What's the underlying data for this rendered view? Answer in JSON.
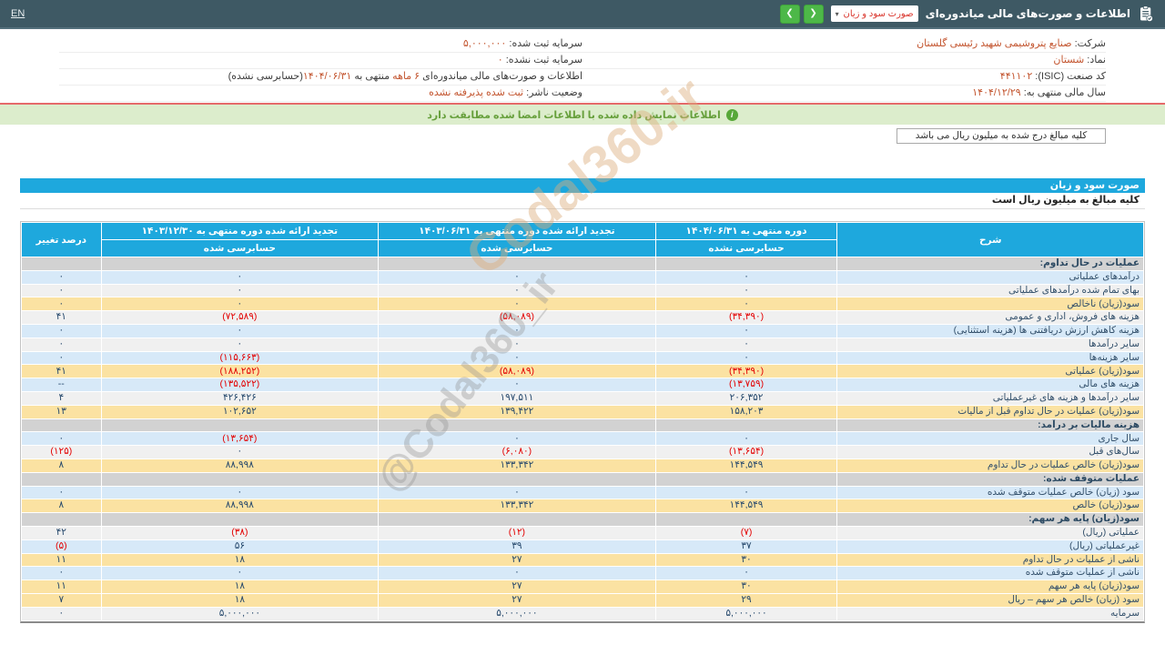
{
  "topbar": {
    "title": "اطلاعات و صورت‌های مالی میاندوره‌ای",
    "statement_select": "صورت سود و زیان",
    "caret_icon": "▾",
    "nav_back": "❮",
    "nav_forward": "❯",
    "lang_link": "EN"
  },
  "info": {
    "right_rows": [
      {
        "segments": [
          {
            "t": "شرکت: ",
            "c": "l"
          },
          {
            "t": "صنایع پتروشیمی شهید رئیسی گلستان",
            "c": "v"
          }
        ]
      },
      {
        "segments": [
          {
            "t": "نماد: ",
            "c": "l"
          },
          {
            "t": "شستان",
            "c": "v"
          }
        ]
      },
      {
        "segments": [
          {
            "t": "کد صنعت (ISIC): ",
            "c": "l"
          },
          {
            "t": "۴۴۱۱۰۲",
            "c": "v"
          }
        ]
      },
      {
        "segments": [
          {
            "t": "سال مالی منتهی به: ",
            "c": "l"
          },
          {
            "t": "۱۴۰۴/۱۲/۲۹",
            "c": "v"
          }
        ]
      }
    ],
    "left_rows": [
      {
        "segments": [
          {
            "t": "سرمایه ثبت شده: ",
            "c": "l"
          },
          {
            "t": "۵,۰۰۰,۰۰۰",
            "c": "v"
          }
        ]
      },
      {
        "segments": [
          {
            "t": "سرمایه ثبت نشده: ",
            "c": "l"
          },
          {
            "t": "۰",
            "c": "v"
          }
        ]
      },
      {
        "segments": [
          {
            "t": "اطلاعات و صورت‌های مالی میاندوره‌ای ",
            "c": "l"
          },
          {
            "t": "۶ ماهه",
            "c": "v"
          },
          {
            "t": " منتهی به ",
            "c": "l"
          },
          {
            "t": "۱۴۰۴/۰۶/۳۱",
            "c": "v"
          },
          {
            "t": "(حسابرسی نشده)",
            "c": "l"
          }
        ]
      },
      {
        "segments": [
          {
            "t": "وضعیت ناشر: ",
            "c": "l"
          },
          {
            "t": "ثبت شده پذیرفته نشده",
            "c": "v"
          }
        ]
      }
    ]
  },
  "bars": {
    "signed_match": "اطلاعات نمایش داده شده با اطلاعات امضا شده مطابقت دارد",
    "info_icon": "i",
    "units_note": "کلیه مبالغ درج شده به میلیون ریال می باشد"
  },
  "statement": {
    "title": "صورت سود و زیان",
    "units": "کلیه مبالغ به میلیون ریال است"
  },
  "table": {
    "desc_header": "شرح",
    "pct_header": "درصد تغییر",
    "period_cols": [
      {
        "title": "دوره منتهی به ۱۴۰۴/۰۶/۳۱",
        "sub": "حسابرسی نشده"
      },
      {
        "title": "تجدید ارائه شده دوره منتهی به ۱۴۰۳/۰۶/۳۱",
        "sub": "حسابرسی شده"
      },
      {
        "title": "تجدید ارائه شده دوره منتهی به ۱۴۰۳/۱۲/۳۰",
        "sub": "حسابرسی شده"
      }
    ],
    "rows": [
      {
        "type": "section",
        "label": "عملیات در حال تداوم:"
      },
      {
        "type": "data",
        "style": "blue",
        "label": "درآمدهای عملیاتی",
        "v": [
          "۰",
          "۰",
          "۰",
          "۰"
        ]
      },
      {
        "type": "data",
        "style": "white",
        "label": "بهای تمام شده درآمدهای عملیاتی",
        "v": [
          "۰",
          "۰",
          "۰",
          "۰"
        ]
      },
      {
        "type": "data",
        "style": "yellow",
        "label": "سود(زیان) ناخالص",
        "v": [
          "۰",
          "۰",
          "۰",
          "۰"
        ]
      },
      {
        "type": "data",
        "style": "white",
        "label": "هزینه های فروش، اداری و عمومی",
        "v": [
          "(۳۴,۳۹۰)",
          "(۵۸,۰۸۹)",
          "(۷۲,۵۸۹)",
          "۴۱"
        ]
      },
      {
        "type": "data",
        "style": "blue",
        "label": "هزینه کاهش ارزش دریافتنی ها (هزینه استثنایی)",
        "v": [
          "۰",
          "۰",
          "۰",
          "۰"
        ]
      },
      {
        "type": "data",
        "style": "white",
        "label": "سایر درآمدها",
        "v": [
          "۰",
          "۰",
          "۰",
          "۰"
        ]
      },
      {
        "type": "data",
        "style": "blue",
        "label": "سایر هزینه‌ها",
        "v": [
          "۰",
          "۰",
          "(۱۱۵,۶۶۳)",
          "۰"
        ]
      },
      {
        "type": "data",
        "style": "yellow",
        "label": "سود(زیان) عملیاتی",
        "v": [
          "(۳۴,۳۹۰)",
          "(۵۸,۰۸۹)",
          "(۱۸۸,۲۵۲)",
          "۴۱"
        ]
      },
      {
        "type": "data",
        "style": "blue",
        "label": "هزینه های مالی",
        "v": [
          "(۱۳,۷۵۹)",
          "۰",
          "(۱۳۵,۵۲۲)",
          "--"
        ]
      },
      {
        "type": "data",
        "style": "white",
        "label": "سایر درآمدها و هزینه های غیرعملیاتی",
        "v": [
          "۲۰۶,۳۵۲",
          "۱۹۷,۵۱۱",
          "۴۲۶,۴۲۶",
          "۴"
        ]
      },
      {
        "type": "data",
        "style": "yellow",
        "label": "سود(زیان) عملیات در حال تداوم قبل از مالیات",
        "v": [
          "۱۵۸,۲۰۳",
          "۱۳۹,۴۲۲",
          "۱۰۲,۶۵۲",
          "۱۳"
        ]
      },
      {
        "type": "section",
        "label": "هزینه مالیات بر درآمد:"
      },
      {
        "type": "data",
        "style": "blue",
        "label": "سال جاری",
        "v": [
          "۰",
          "۰",
          "(۱۳,۶۵۴)",
          "۰"
        ]
      },
      {
        "type": "data",
        "style": "white",
        "label": "سال‌های قبل",
        "v": [
          "(۱۳,۶۵۴)",
          "(۶,۰۸۰)",
          "۰",
          "(۱۲۵)"
        ]
      },
      {
        "type": "data",
        "style": "yellow",
        "label": "سود(زیان) خالص عملیات در حال تداوم",
        "v": [
          "۱۴۴,۵۴۹",
          "۱۳۳,۳۴۲",
          "۸۸,۹۹۸",
          "۸"
        ]
      },
      {
        "type": "section",
        "label": "عملیات متوقف شده:"
      },
      {
        "type": "data",
        "style": "blue",
        "label": "سود (زیان) خالص عملیات متوقف شده",
        "v": [
          "۰",
          "۰",
          "۰",
          "۰"
        ]
      },
      {
        "type": "data",
        "style": "yellow",
        "label": "سود(زیان) خالص",
        "v": [
          "۱۴۴,۵۴۹",
          "۱۳۳,۳۴۲",
          "۸۸,۹۹۸",
          "۸"
        ]
      },
      {
        "type": "section",
        "label": "سود(زیان) پایه هر سهم:"
      },
      {
        "type": "data",
        "style": "white",
        "label": "عملیاتی (ریال)",
        "v": [
          "(۷)",
          "(۱۲)",
          "(۳۸)",
          "۴۲"
        ]
      },
      {
        "type": "data",
        "style": "blue",
        "label": "غیرعملیاتی (ریال)",
        "v": [
          "۳۷",
          "۳۹",
          "۵۶",
          "(۵)"
        ]
      },
      {
        "type": "data",
        "style": "yellow",
        "label": "ناشی از عملیات در حال تداوم",
        "v": [
          "۳۰",
          "۲۷",
          "۱۸",
          "۱۱"
        ]
      },
      {
        "type": "data",
        "style": "blue",
        "label": "ناشی از عملیات متوقف شده",
        "v": [
          "۰",
          "۰",
          "۰",
          "۰"
        ]
      },
      {
        "type": "data",
        "style": "yellow",
        "label": "سود(زیان) پایه هر سهم",
        "v": [
          "۳۰",
          "۲۷",
          "۱۸",
          "۱۱"
        ]
      },
      {
        "type": "data",
        "style": "yellow",
        "label": "سود (زیان) خالص هر سهم – ریال",
        "v": [
          "۲۹",
          "۲۷",
          "۱۸",
          "۷"
        ]
      },
      {
        "type": "data",
        "style": "white",
        "label": "سرمایه",
        "v": [
          "۵,۰۰۰,۰۰۰",
          "۵,۰۰۰,۰۰۰",
          "۵,۰۰۰,۰۰۰",
          "۰"
        ]
      }
    ]
  },
  "watermarks": {
    "top": "Codal360.ir",
    "center": "@Codal360_ir"
  },
  "colors": {
    "topbar": "#3e5964",
    "accent_green": "#4db848",
    "header_blue": "#1ea8dd",
    "row_yellow": "#fbe2a2",
    "row_blue": "#d7e9f8",
    "value_negative": "#e30000",
    "info_value": "#c3552f"
  }
}
